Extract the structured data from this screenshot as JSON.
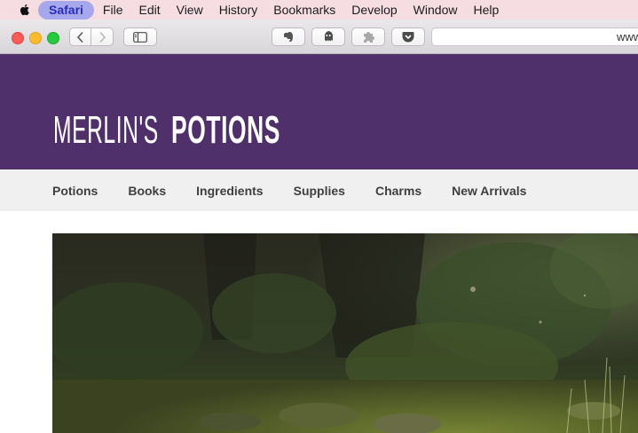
{
  "menubar": {
    "items": [
      "Safari",
      "File",
      "Edit",
      "View",
      "History",
      "Bookmarks",
      "Develop",
      "Window",
      "Help"
    ]
  },
  "toolbar": {
    "url_text": "www",
    "icons": [
      "back-icon",
      "forward-icon",
      "sidebar-icon",
      "evernote-icon",
      "ghostery-icon",
      "puzzle-icon",
      "pocket-icon"
    ]
  },
  "site": {
    "logo_light": "MERLIN'S",
    "logo_bold": "POTIONS",
    "nav": [
      "Potions",
      "Books",
      "Ingredients",
      "Supplies",
      "Charms",
      "New Arrivals"
    ]
  },
  "colors": {
    "header_bg": "#50306a",
    "nav_bg": "#f0f0f0",
    "menubar_bg": "#f5dde2",
    "active_menu_bg": "#a7a8ec"
  }
}
